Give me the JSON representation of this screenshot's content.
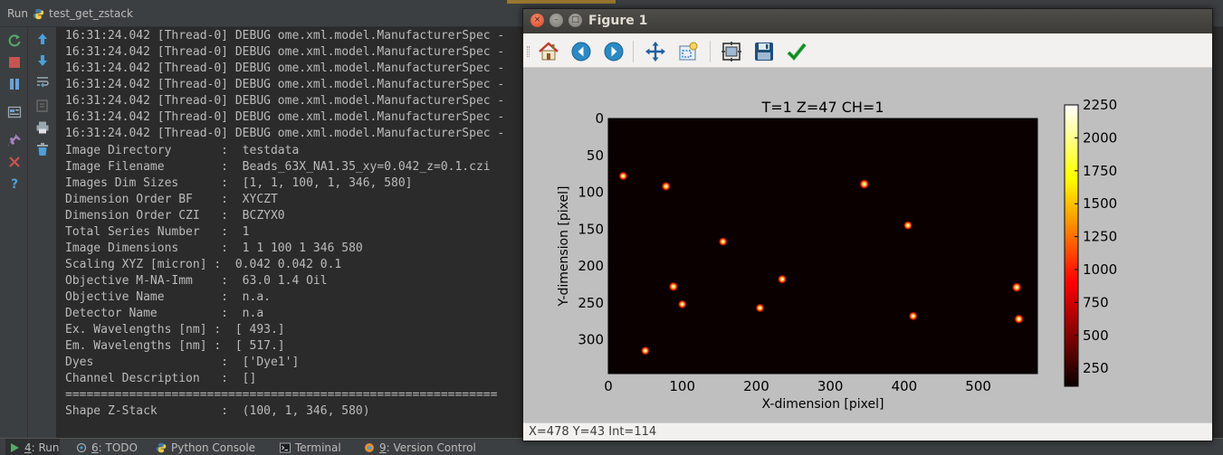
{
  "ide": {
    "run_label": "Run",
    "run_config": "test_get_zstack",
    "console_lines": [
      "16:31:24.042 [Thread-0] DEBUG ome.xml.model.ManufacturerSpec -",
      "16:31:24.042 [Thread-0] DEBUG ome.xml.model.ManufacturerSpec -",
      "16:31:24.042 [Thread-0] DEBUG ome.xml.model.ManufacturerSpec -",
      "16:31:24.042 [Thread-0] DEBUG ome.xml.model.ManufacturerSpec -",
      "16:31:24.042 [Thread-0] DEBUG ome.xml.model.ManufacturerSpec -",
      "16:31:24.042 [Thread-0] DEBUG ome.xml.model.ManufacturerSpec -",
      "16:31:24.042 [Thread-0] DEBUG ome.xml.model.ManufacturerSpec -",
      "Image Directory       :  testdata",
      "Image Filename        :  Beads_63X_NA1.35_xy=0.042_z=0.1.czi",
      "Images Dim Sizes      :  [1, 1, 100, 1, 346, 580]",
      "Dimension Order BF    :  XYCZT",
      "Dimension Order CZI   :  BCZYX0",
      "Total Series Number   :  1",
      "Image Dimensions      :  1 1 100 1 346 580",
      "Scaling XYZ [micron] :  0.042 0.042 0.1",
      "Objective M-NA-Imm    :  63.0 1.4 Oil",
      "Objective Name        :  n.a.",
      "Detector Name         :  n.a",
      "Ex. Wavelengths [nm] :  [ 493.]",
      "Em. Wavelengths [nm] :  [ 517.]",
      "Dyes                  :  ['Dye1']",
      "Channel Description   :  []",
      "=============================================================",
      "Shape Z-Stack         :  (100, 1, 346, 580)"
    ],
    "bottom_tabs": [
      {
        "num": "4",
        "label": ": Run"
      },
      {
        "num": "6",
        "label": ": TODO"
      },
      {
        "num": "",
        "label": "Python Console"
      },
      {
        "num": "",
        "label": "Terminal"
      },
      {
        "num": "9",
        "label": ": Version Control"
      }
    ],
    "colors": {
      "background": "#2b2b2b",
      "panel": "#3c3f41",
      "text": "#bbbbbb"
    }
  },
  "figure": {
    "window_title": "Figure 1",
    "window_controls": {
      "close": "×",
      "minimize": "–",
      "maximize": "□"
    },
    "toolbar_icons": [
      "home-icon",
      "back-arrow-icon",
      "forward-arrow-icon",
      "pan-icon",
      "zoom-icon",
      "subplots-config-icon",
      "save-icon",
      "edit-check-icon"
    ],
    "status_text": "X=478 Y=43 Int=114"
  },
  "chart_data": {
    "type": "heatmap",
    "title": "T=1 Z=47 CH=1",
    "xlabel": "X-dimension [pixel]",
    "ylabel": "Y-dimension [pixel]",
    "xlim": [
      0,
      580
    ],
    "ylim": [
      346,
      0
    ],
    "x_ticks": [
      0,
      100,
      200,
      300,
      400,
      500
    ],
    "y_ticks": [
      0,
      50,
      100,
      150,
      200,
      250,
      300
    ],
    "colormap": "hot",
    "background_intensity": 114,
    "colorbar": {
      "min": 114,
      "max": 2250,
      "ticks": [
        250,
        500,
        750,
        1000,
        1250,
        1500,
        1750,
        2000,
        2250
      ]
    },
    "spots": [
      {
        "x": 20,
        "y": 78,
        "value": 1400
      },
      {
        "x": 78,
        "y": 92,
        "value": 1450
      },
      {
        "x": 346,
        "y": 89,
        "value": 1700
      },
      {
        "x": 405,
        "y": 145,
        "value": 1400
      },
      {
        "x": 155,
        "y": 167,
        "value": 1350
      },
      {
        "x": 235,
        "y": 218,
        "value": 1450
      },
      {
        "x": 88,
        "y": 228,
        "value": 1600
      },
      {
        "x": 552,
        "y": 229,
        "value": 1700
      },
      {
        "x": 100,
        "y": 252,
        "value": 1300
      },
      {
        "x": 205,
        "y": 257,
        "value": 1400
      },
      {
        "x": 412,
        "y": 268,
        "value": 1400
      },
      {
        "x": 555,
        "y": 272,
        "value": 1600
      },
      {
        "x": 50,
        "y": 315,
        "value": 1350
      }
    ]
  }
}
